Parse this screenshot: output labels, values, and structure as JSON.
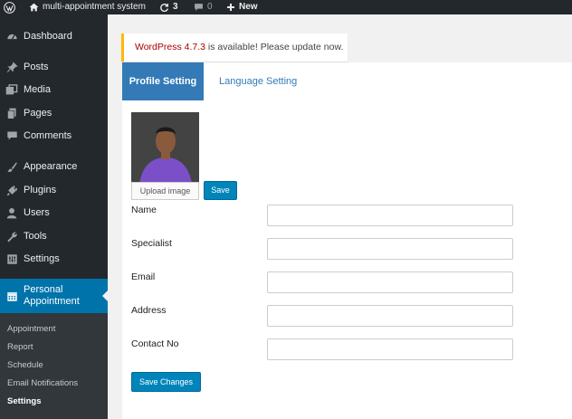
{
  "adminbar": {
    "site_name": "multi-appointment system",
    "updates_count": "3",
    "comments_count": "0",
    "new_label": "New"
  },
  "sidebar": {
    "items": [
      {
        "label": "Dashboard",
        "icon": "dashboard-icon"
      },
      {
        "label": "Posts",
        "icon": "pin-icon"
      },
      {
        "label": "Media",
        "icon": "media-icon"
      },
      {
        "label": "Pages",
        "icon": "pages-icon"
      },
      {
        "label": "Comments",
        "icon": "comment-icon"
      },
      {
        "label": "Appearance",
        "icon": "brush-icon"
      },
      {
        "label": "Plugins",
        "icon": "plug-icon"
      },
      {
        "label": "Users",
        "icon": "user-icon"
      },
      {
        "label": "Tools",
        "icon": "wrench-icon"
      },
      {
        "label": "Settings",
        "icon": "settings-icon"
      }
    ],
    "current": {
      "line1": "Personal",
      "line2": "Appointment",
      "icon": "calendar-icon"
    },
    "submenu": [
      "Appointment",
      "Report",
      "Schedule",
      "Email Notifications",
      "Settings"
    ]
  },
  "notice": {
    "link_text": "WordPress 4.7.3",
    "message": " is available! Please update now."
  },
  "tabs": {
    "profile": "Profile Setting",
    "language": "Language Setting"
  },
  "profile": {
    "upload_label": "Upload image",
    "save_label": "Save",
    "fields": [
      {
        "label": "Name",
        "value": ""
      },
      {
        "label": "Specialist",
        "value": ""
      },
      {
        "label": "Email",
        "value": ""
      },
      {
        "label": "Address",
        "value": ""
      },
      {
        "label": "Contact No",
        "value": ""
      }
    ],
    "save_changes_label": "Save Changes"
  },
  "colors": {
    "accent": "#0073aa",
    "tab_active": "#337ab7",
    "button": "#0085ba",
    "adminbar": "#23282d",
    "notice_border": "#ffb900"
  }
}
